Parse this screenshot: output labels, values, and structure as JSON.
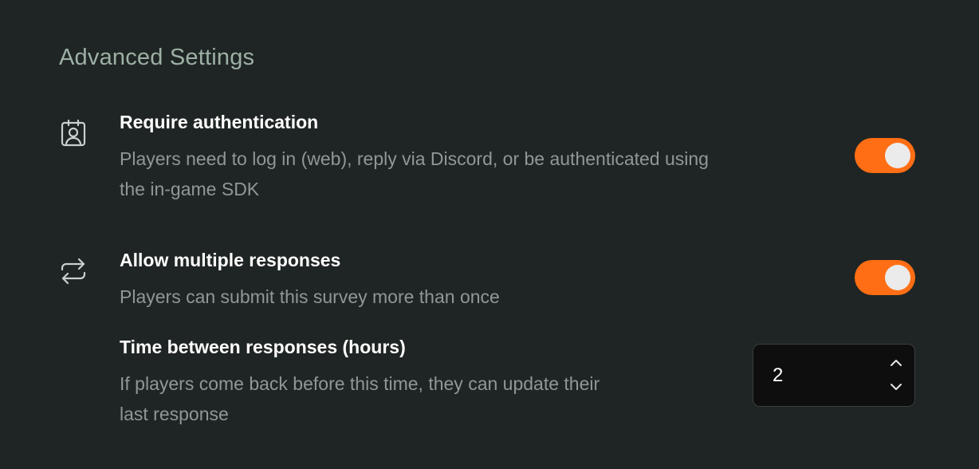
{
  "section": {
    "title": "Advanced Settings"
  },
  "settings": [
    {
      "icon": "user-badge-icon",
      "title": "Require authentication",
      "description_lines": [
        "Players need to log in (web), reply via Discord, or be authenticated using",
        "the in-game SDK"
      ],
      "enabled": true
    },
    {
      "icon": "repeat-arrows-icon",
      "title": "Allow multiple responses",
      "description_lines": [
        "Players can submit this survey more than once"
      ],
      "enabled": true
    }
  ],
  "time_between": {
    "title": "Time between responses (hours)",
    "description_lines": [
      "If players come back before this time, they can update their",
      "last response"
    ],
    "value": "2",
    "increment_icon": "chevron-up-icon",
    "decrement_icon": "chevron-down-icon"
  },
  "colors": {
    "background": "#1f2524",
    "accent": "#ff6e14",
    "section_title": "#9db0a5",
    "description": "#8e9896"
  }
}
